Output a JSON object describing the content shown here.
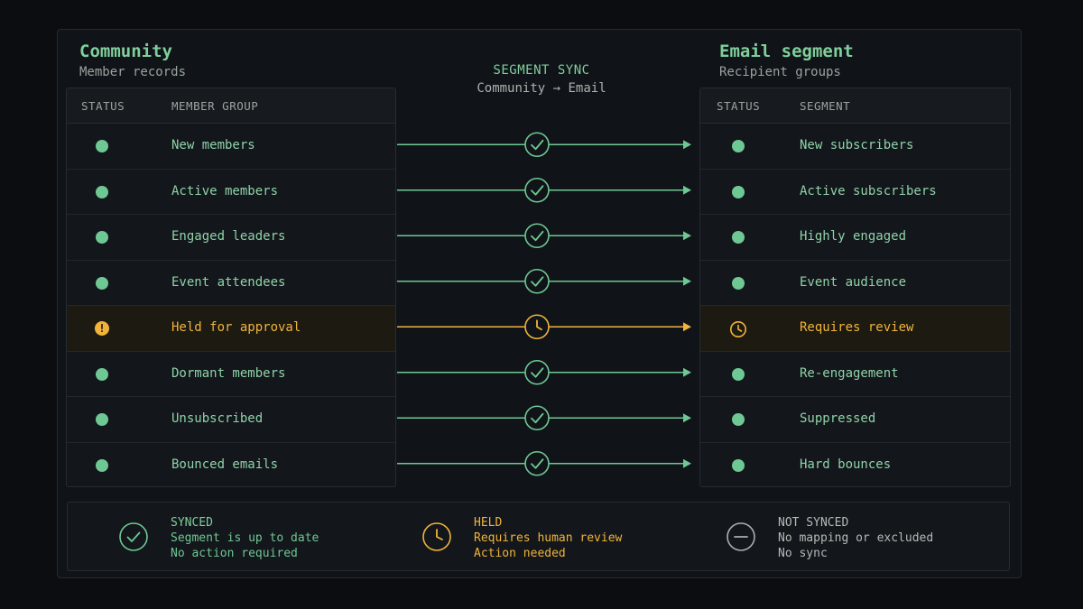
{
  "left": {
    "title": "Community",
    "subtitle": "Member records",
    "headers": {
      "status": "STATUS",
      "group": "MEMBER GROUP"
    }
  },
  "right": {
    "title": "Email segment",
    "subtitle": "Recipient groups",
    "headers": {
      "status": "STATUS",
      "segment": "SEGMENT"
    }
  },
  "center": {
    "title": "SEGMENT SYNC",
    "subtitle": "Community → Email"
  },
  "mappings": [
    {
      "source": "New members",
      "target": "New subscribers",
      "status": "synced"
    },
    {
      "source": "Active members",
      "target": "Active subscribers",
      "status": "synced"
    },
    {
      "source": "Engaged leaders",
      "target": "Highly engaged",
      "status": "synced"
    },
    {
      "source": "Event attendees",
      "target": "Event audience",
      "status": "synced"
    },
    {
      "source": "Held for approval",
      "target": "Requires review",
      "status": "held"
    },
    {
      "source": "Dormant members",
      "target": "Re-engagement",
      "status": "synced"
    },
    {
      "source": "Unsubscribed",
      "target": "Suppressed",
      "status": "synced"
    },
    {
      "source": "Bounced emails",
      "target": "Hard bounces",
      "status": "synced"
    }
  ],
  "legend": {
    "synced": {
      "title": "SYNCED",
      "line1": "Segment is up to date",
      "line2": "No action required"
    },
    "held": {
      "title": "HELD",
      "line1": "Requires human review",
      "line2": "Action needed"
    },
    "not_synced": {
      "title": "NOT SYNCED",
      "line1": "No mapping or excluded",
      "line2": "No sync"
    }
  },
  "colors": {
    "synced": "#6ec894",
    "held": "#f0b43a",
    "neutral": "#a9b0ad"
  }
}
